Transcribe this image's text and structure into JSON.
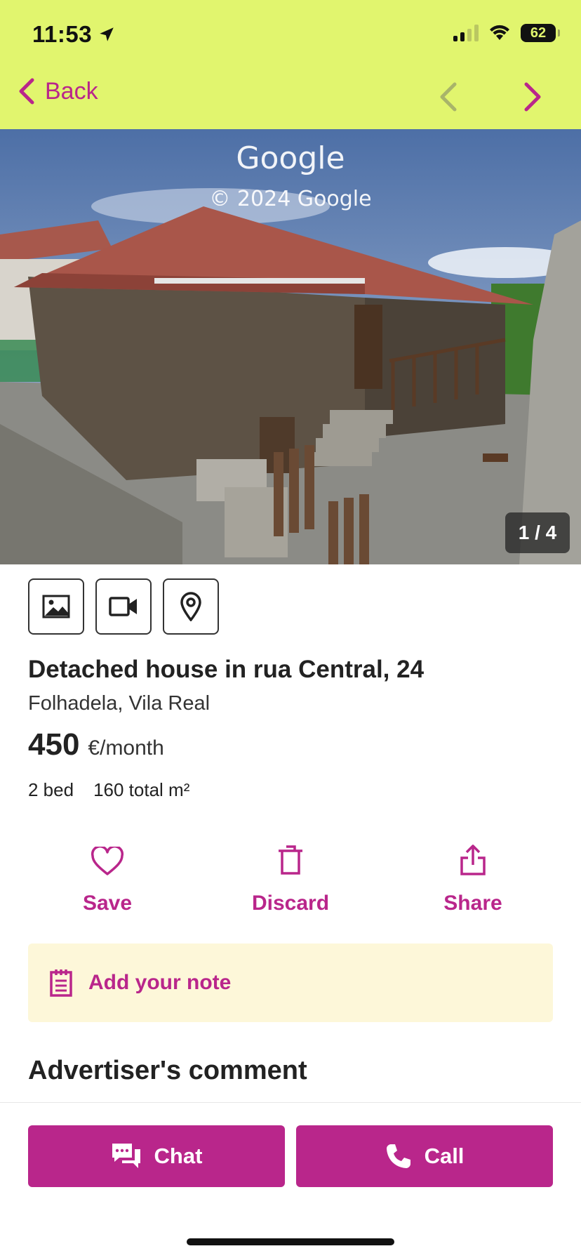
{
  "status_bar": {
    "time": "11:53",
    "battery": "62"
  },
  "nav": {
    "back_label": "Back"
  },
  "photo": {
    "watermark_brand": "Google",
    "watermark_copyright": "© 2024 Google",
    "counter": "1 / 4"
  },
  "media_buttons": {
    "icons": [
      "image-icon",
      "video-icon",
      "map-pin-icon"
    ]
  },
  "listing": {
    "title": "Detached house in rua Central, 24",
    "location": "Folhadela, Vila Real",
    "price": "450",
    "price_unit": "€/month",
    "bedrooms": "2 bed",
    "area": "160 total m²"
  },
  "actions": {
    "save_label": "Save",
    "discard_label": "Discard",
    "share_label": "Share"
  },
  "note": {
    "label": "Add your note"
  },
  "sections": {
    "advertiser_comment_title": "Advertiser's comment"
  },
  "bottom_bar": {
    "chat_label": "Chat",
    "call_label": "Call"
  },
  "colors": {
    "header_bg": "#e1f56e",
    "accent": "#b9268b",
    "note_bg": "#fdf7d9"
  }
}
